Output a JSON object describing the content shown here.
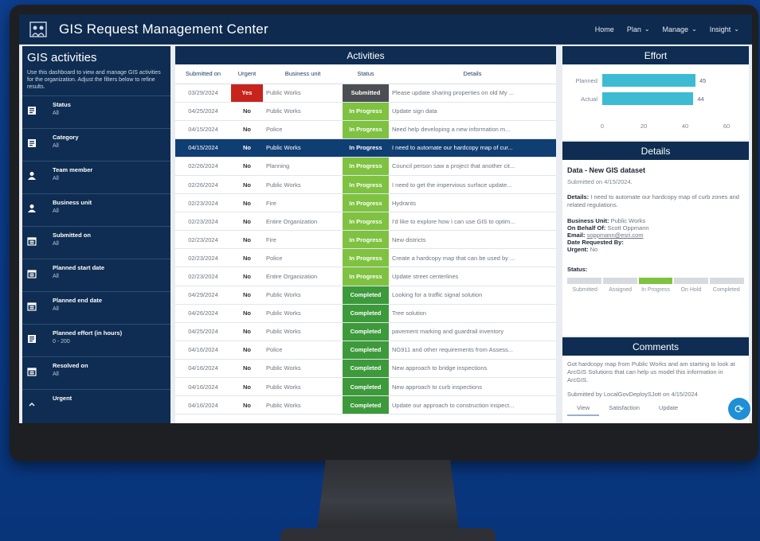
{
  "header": {
    "title": "GIS Request Management Center",
    "nav": [
      {
        "label": "Home",
        "has_dropdown": false
      },
      {
        "label": "Plan",
        "has_dropdown": true
      },
      {
        "label": "Manage",
        "has_dropdown": true
      },
      {
        "label": "Insight",
        "has_dropdown": true
      }
    ]
  },
  "sidebar": {
    "title": "GIS activities",
    "description": "Use this dashboard to view and manage GIS activities for the organization. Adjust the filters below to refine results.",
    "filters": [
      {
        "label": "Status",
        "value": "All",
        "icon": "list-icon"
      },
      {
        "label": "Category",
        "value": "All",
        "icon": "list-icon"
      },
      {
        "label": "Team member",
        "value": "All",
        "icon": "person-icon"
      },
      {
        "label": "Business unit",
        "value": "All",
        "icon": "person-icon"
      },
      {
        "label": "Submitted on",
        "value": "All",
        "icon": "calendar-icon"
      },
      {
        "label": "Planned start date",
        "value": "All",
        "icon": "calendar-icon"
      },
      {
        "label": "Planned end date",
        "value": "All",
        "icon": "calendar-icon"
      },
      {
        "label": "Planned effort (in hours)",
        "value": "0 - 200",
        "icon": "list-icon"
      },
      {
        "label": "Resolved on",
        "value": "All",
        "icon": "calendar-icon"
      },
      {
        "label": "Urgent",
        "value": "",
        "icon": "chevron-up-icon"
      }
    ]
  },
  "activities": {
    "title": "Activities",
    "columns": [
      "Submitted on",
      "Urgent",
      "Business unit",
      "Status",
      "Details"
    ],
    "rows": [
      {
        "date": "03/29/2024",
        "urgent": "Yes",
        "unit": "Public Works",
        "status": "Submitted",
        "details": "Please update sharing properties on old My ..."
      },
      {
        "date": "04/25/2024",
        "urgent": "No",
        "unit": "Public Works",
        "status": "In Progress",
        "details": "Update sign data"
      },
      {
        "date": "04/15/2024",
        "urgent": "No",
        "unit": "Police",
        "status": "In Progress",
        "details": "Need help developing a new information m..."
      },
      {
        "date": "04/15/2024",
        "urgent": "No",
        "unit": "Public Works",
        "status": "In Progress",
        "details": "I need to automate our hardcopy map of cur..."
      },
      {
        "date": "02/26/2024",
        "urgent": "No",
        "unit": "Planning",
        "status": "In Progress",
        "details": "Council person saw a project that another cit..."
      },
      {
        "date": "02/26/2024",
        "urgent": "No",
        "unit": "Public Works",
        "status": "In Progress",
        "details": "I need to get the impervious surface update..."
      },
      {
        "date": "02/23/2024",
        "urgent": "No",
        "unit": "Fire",
        "status": "In Progress",
        "details": "Hydrants"
      },
      {
        "date": "02/23/2024",
        "urgent": "No",
        "unit": "Entire Organization",
        "status": "In Progress",
        "details": "I'd like to explore how I can use GIS to optim..."
      },
      {
        "date": "02/23/2024",
        "urgent": "No",
        "unit": "Fire",
        "status": "In Progress",
        "details": "New districts"
      },
      {
        "date": "02/23/2024",
        "urgent": "No",
        "unit": "Police",
        "status": "In Progress",
        "details": "Create a hardcopy map that can be used by ..."
      },
      {
        "date": "02/23/2024",
        "urgent": "No",
        "unit": "Entire Organization",
        "status": "In Progress",
        "details": "Update street centerlines"
      },
      {
        "date": "04/29/2024",
        "urgent": "No",
        "unit": "Public Works",
        "status": "Completed",
        "details": "Looking for a traffic signal solution"
      },
      {
        "date": "04/26/2024",
        "urgent": "No",
        "unit": "Public Works",
        "status": "Completed",
        "details": "Tree solution"
      },
      {
        "date": "04/25/2024",
        "urgent": "No",
        "unit": "Public Works",
        "status": "Completed",
        "details": "pavement marking and guardrail inventory"
      },
      {
        "date": "04/16/2024",
        "urgent": "No",
        "unit": "Police",
        "status": "Completed",
        "details": "NG911 and other requirements from Assess..."
      },
      {
        "date": "04/16/2024",
        "urgent": "No",
        "unit": "Public Works",
        "status": "Completed",
        "details": "New approach to bridge inspections"
      },
      {
        "date": "04/16/2024",
        "urgent": "No",
        "unit": "Public Works",
        "status": "Completed",
        "details": "New approach to curb inspections"
      },
      {
        "date": "04/16/2024",
        "urgent": "No",
        "unit": "Public Works",
        "status": "Completed",
        "details": "Update our approach to construction inspect..."
      }
    ],
    "selected_row": 3
  },
  "effort": {
    "title": "Effort",
    "chart_data": {
      "type": "bar",
      "orientation": "horizontal",
      "categories": [
        "Planned",
        "Actual"
      ],
      "values": [
        45,
        44
      ],
      "xlim": [
        0,
        60
      ],
      "ticks": [
        "0",
        "20",
        "40",
        "60"
      ],
      "value_labels": [
        "45",
        "44"
      ],
      "grid": false
    }
  },
  "details": {
    "title": "Details",
    "heading": "Data - New GIS dataset",
    "submitted": "Submitted on 4/15/2024.",
    "details_label": "Details:",
    "details_text": "I need to automate our hardcopy map of curb zones and related regulations.",
    "business_unit_label": "Business Unit:",
    "business_unit": "Public Works",
    "behalf_label": "On Behalf Of:",
    "behalf": "Scott Oppmann",
    "email_label": "Email:",
    "email": "soppmann@esri.com",
    "date_requested_label": "Date Requested By:",
    "urgent_label": "Urgent:",
    "urgent": "No",
    "status_label": "Status:",
    "steps": [
      "Submitted",
      "Assigned",
      "In Progress",
      "On Hold",
      "Completed"
    ],
    "active_step": 2
  },
  "comments": {
    "title": "Comments",
    "text": "Got hardcopy map from Public Works and am starting to look at ArcGIS Solutions that can help us model this information in ArcGIS.",
    "by": "Submitted by LocalGovDeploySJott on 4/15/2024",
    "tabs": [
      "View",
      "Satisfaction",
      "Update"
    ],
    "active_tab": 0
  },
  "colors": {
    "navy": "#0f2d52",
    "submitted": "#4b4e52",
    "in_progress": "#7fc241",
    "completed": "#3d9a3b",
    "urgent_yes": "#c7241e",
    "effort_bar": "#3dbbd3"
  }
}
